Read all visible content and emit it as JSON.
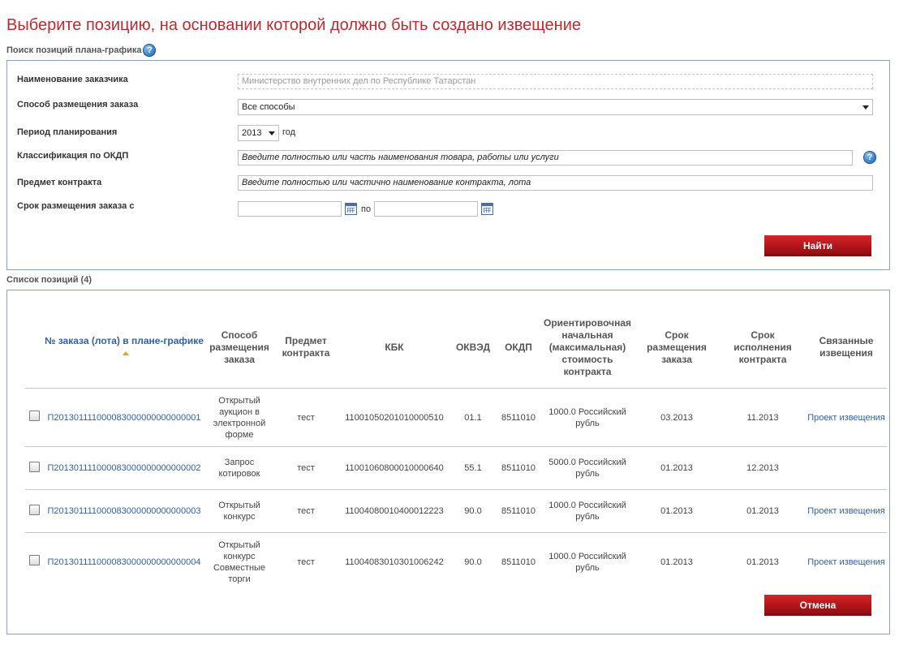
{
  "title": "Выберите позицию, на основании которой должно быть создано извещение",
  "search": {
    "label": "Поиск позиций плана-графика",
    "help_glyph": "?",
    "fields": {
      "customer_label": "Наименование заказчика",
      "customer_value": "Министерство внутренних дел по Республике Татарстан",
      "method_label": "Способ размещения заказа",
      "method_value": "Все способы",
      "period_label": "Период планирования",
      "period_value": "2013",
      "period_unit": "год",
      "okdp_label": "Классификация по ОКДП",
      "okdp_placeholder": "Введите полностью или часть наименования товара, работы или услуги",
      "subject_label": "Предмет контракта",
      "subject_placeholder": "Введите полностью или частично наименование контракта, лота",
      "term_label": "Срок размещения заказа с",
      "term_to": "по"
    },
    "find_button": "Найти"
  },
  "list": {
    "label": "Список позиций (4)",
    "columns": [
      "№ заказа (лота) в плане-графике",
      "Способ размещения заказа",
      "Предмет контракта",
      "КБК",
      "ОКВЭД",
      "ОКДП",
      "Ориентировочная начальная (максимальная) стоимость контракта",
      "Срок размещения заказа",
      "Срок исполнения контракта",
      "Связанные извещения"
    ],
    "rows": [
      {
        "number": "П201301111000083000000000000001",
        "method": "Открытый аукцион в электронной форме",
        "subject": "тест",
        "kbk": "11001050201010000510",
        "okved": "01.1",
        "okdp": "8511010",
        "price": "1000.0 Российский рубль",
        "placement": "03.2013",
        "execution": "11.2013",
        "notice": "Проект извещения"
      },
      {
        "number": "П201301111000083000000000000002",
        "method": "Запрос котировок",
        "subject": "тест",
        "kbk": "11001060800010000640",
        "okved": "55.1",
        "okdp": "8511010",
        "price": "5000.0 Российский рубль",
        "placement": "01.2013",
        "execution": "12.2013",
        "notice": ""
      },
      {
        "number": "П201301111000083000000000000003",
        "method": "Открытый конкурс",
        "subject": "тест",
        "kbk": "11004080010400012223",
        "okved": "90.0",
        "okdp": "8511010",
        "price": "1000.0 Российский рубль",
        "placement": "01.2013",
        "execution": "01.2013",
        "notice": "Проект извещения"
      },
      {
        "number": "П201301111000083000000000000004",
        "method": "Открытый конкурс Совместные торги",
        "subject": "тест",
        "kbk": "11004083010301006242",
        "okved": "90.0",
        "okdp": "8511010",
        "price": "1000.0 Российский рубль",
        "placement": "01.2013",
        "execution": "01.2013",
        "notice": "Проект извещения"
      }
    ],
    "cancel_button": "Отмена"
  },
  "icons": {
    "help": "help-icon",
    "calendar": "calendar-icon",
    "dropdown": "chevron-down-icon",
    "sort": "sort-asc-icon"
  },
  "colors": {
    "title": "#c0282e",
    "button": "#b01418",
    "link": "#2f62a7",
    "border": "#8aa2bb"
  }
}
